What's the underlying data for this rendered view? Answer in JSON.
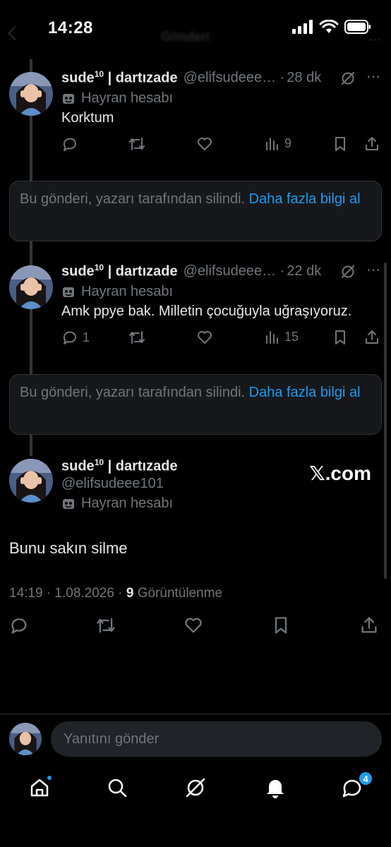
{
  "status_bar": {
    "time": "14:28",
    "title_blurred": "Gönderi"
  },
  "tweets": [
    {
      "display_name": "sude",
      "name_sup": "10",
      "name_suffix": "dartızade",
      "handle": "@elifsudeee101",
      "time": "28 dk",
      "badge": "Hayran hesabı",
      "text": "Korktum",
      "replies": "",
      "views": "9"
    },
    {
      "display_name": "sude",
      "name_sup": "10",
      "name_suffix": "dartızade",
      "handle": "@elifsudeee101",
      "time": "22 dk",
      "badge": "Hayran hesabı",
      "text": "Amk ppye bak. Milletin çocuğuyla uğraşıyoruz.",
      "replies": "1",
      "views": "15"
    }
  ],
  "deleted_notices": [
    {
      "text": "Bu gönderi, yazarı tarafından silindi.",
      "link": "Daha fazla bilgi al"
    },
    {
      "text": "Bu gönderi, yazarı tarafından silindi.",
      "link": "Daha fazla bilgi al"
    }
  ],
  "main_tweet": {
    "display_name": "sude",
    "name_sup": "10",
    "name_suffix": "dartızade",
    "handle": "@elifsudeee101",
    "badge": "Hayran hesabı",
    "watermark": "𝕏.com",
    "text": "Bunu sakın silme",
    "timestamp": "14:19 · 1.08.2026 ·",
    "views_count": "9",
    "views_label": "Görüntülenme"
  },
  "reply": {
    "placeholder": "Yanıtını gönder"
  },
  "tabbar": {
    "messages_count": "4"
  },
  "colors": {
    "background": "#000000",
    "accent": "#1d9bf0",
    "muted": "#71767b",
    "text": "#e7e9ea"
  },
  "icons": [
    "reply-icon",
    "retweet-icon",
    "like-icon",
    "views-icon",
    "bookmark-icon",
    "share-icon",
    "grok-icon",
    "more-icon",
    "mask-icon",
    "home-icon",
    "search-icon",
    "notifications-icon",
    "messages-icon"
  ]
}
